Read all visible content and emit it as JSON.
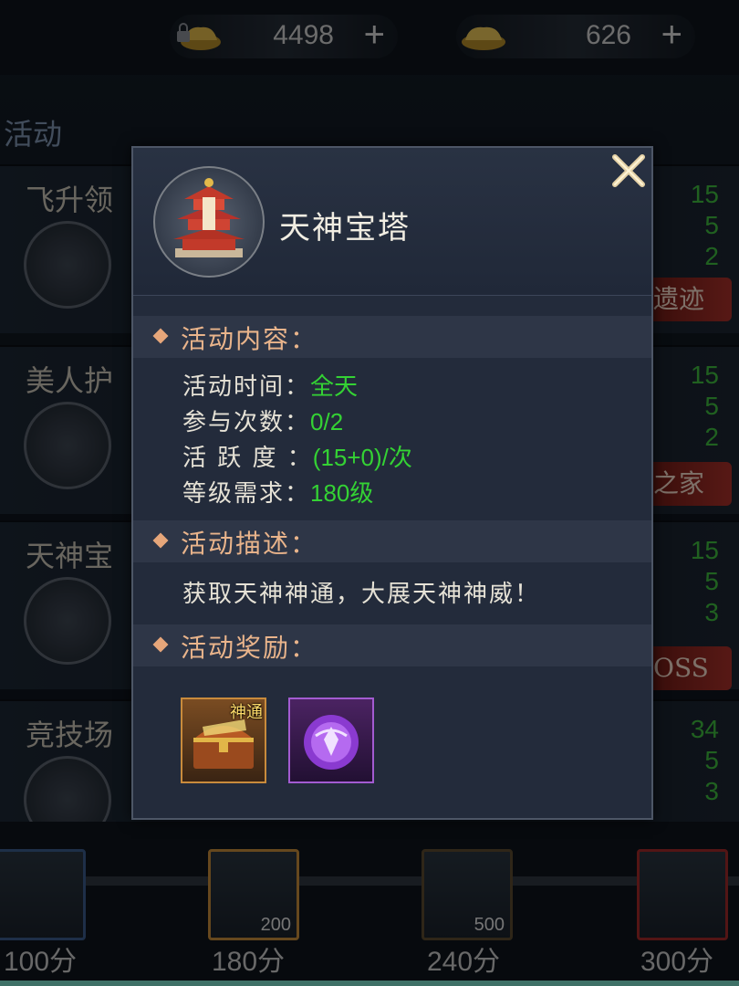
{
  "topbar": {
    "locked_ingot": {
      "value": "4498",
      "plus": "+",
      "icon": "locked-gold-ingot-icon"
    },
    "ingot": {
      "value": "626",
      "plus": "+",
      "icon": "gold-ingot-icon"
    }
  },
  "background": {
    "section_title": "活动",
    "rows": [
      {
        "name": "飞升领",
        "stats": [
          "15",
          "5",
          "2"
        ],
        "tag": ""
      },
      {
        "name": "美人护",
        "stats": [
          "15",
          "5",
          "2"
        ],
        "tag": "遗迹"
      },
      {
        "name": "天神宝",
        "stats": [
          "15",
          "5",
          "3"
        ],
        "tag": "之家"
      },
      {
        "name": "竞技场",
        "stats": [
          "34",
          "5",
          "3"
        ],
        "tag": "OSS"
      }
    ],
    "milestones": [
      {
        "points": "100分",
        "count": ""
      },
      {
        "points": "180分",
        "count": "200"
      },
      {
        "points": "240分",
        "count": "500"
      },
      {
        "points": "300分",
        "count": ""
      }
    ]
  },
  "popup": {
    "title": "天神宝塔",
    "content_section": "活动内容：",
    "info": [
      {
        "key": "活动时间：",
        "value": "全天"
      },
      {
        "key": "参与次数：",
        "value": "0/2"
      },
      {
        "key": "活 跃 度 ：",
        "value": "(15+0)/次"
      },
      {
        "key": "等级需求：",
        "value": "180级"
      }
    ],
    "desc_section": "活动描述：",
    "description": "获取天神神通，大展天神神威！",
    "reward_section": "活动奖励：",
    "rewards": [
      {
        "name": "treasure-chest",
        "badge": "神通"
      },
      {
        "name": "purple-orb",
        "badge": ""
      }
    ]
  },
  "colors": {
    "accent_orange": "#e9b48b",
    "value_green": "#34d234",
    "panel_bg": "#232b3b"
  }
}
